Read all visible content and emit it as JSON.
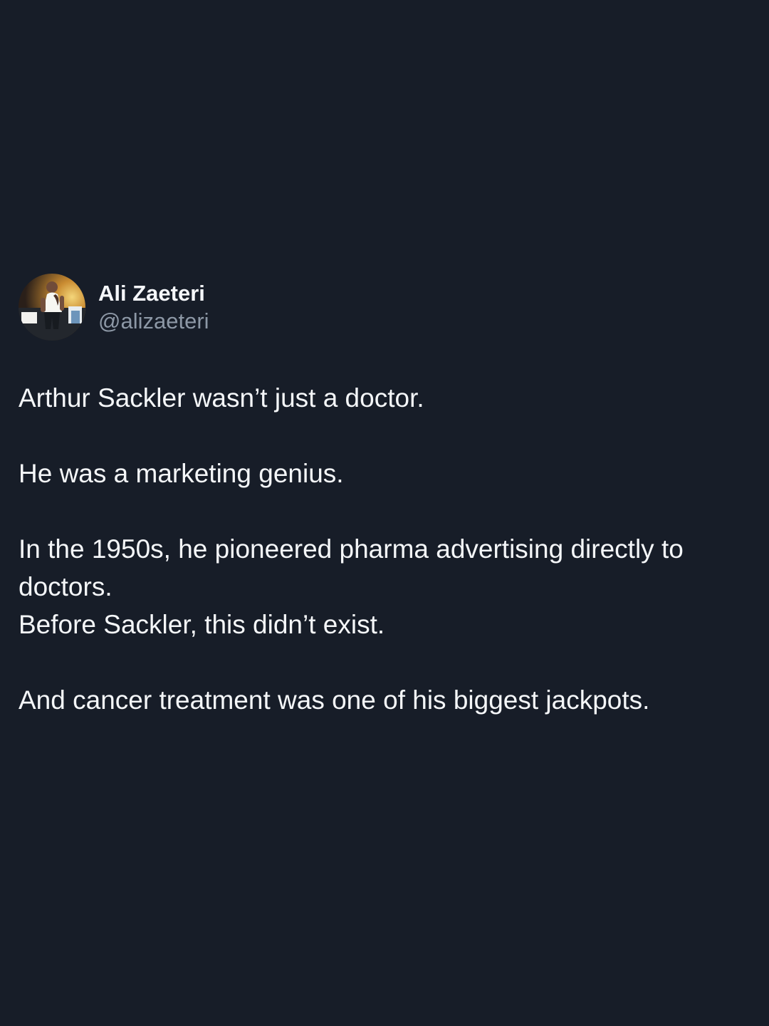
{
  "author": {
    "display_name": "Ali Zaeteri",
    "handle": "@alizaeteri",
    "avatar_icon": "profile-photo"
  },
  "tweet": {
    "paragraph_1": "Arthur Sackler wasn’t just a doctor.",
    "paragraph_2": "He was a marketing genius.",
    "paragraph_3_line_1": "In the 1950s, he pioneered pharma advertising directly to",
    "paragraph_3_line_2": "doctors.",
    "paragraph_3_line_3": "Before Sackler, this didn’t exist.",
    "paragraph_4": "And cancer treatment was one of his biggest jackpots."
  },
  "colors": {
    "background": "#171d28",
    "text_primary": "#f4f6f8",
    "text_secondary": "#8d98a6"
  }
}
